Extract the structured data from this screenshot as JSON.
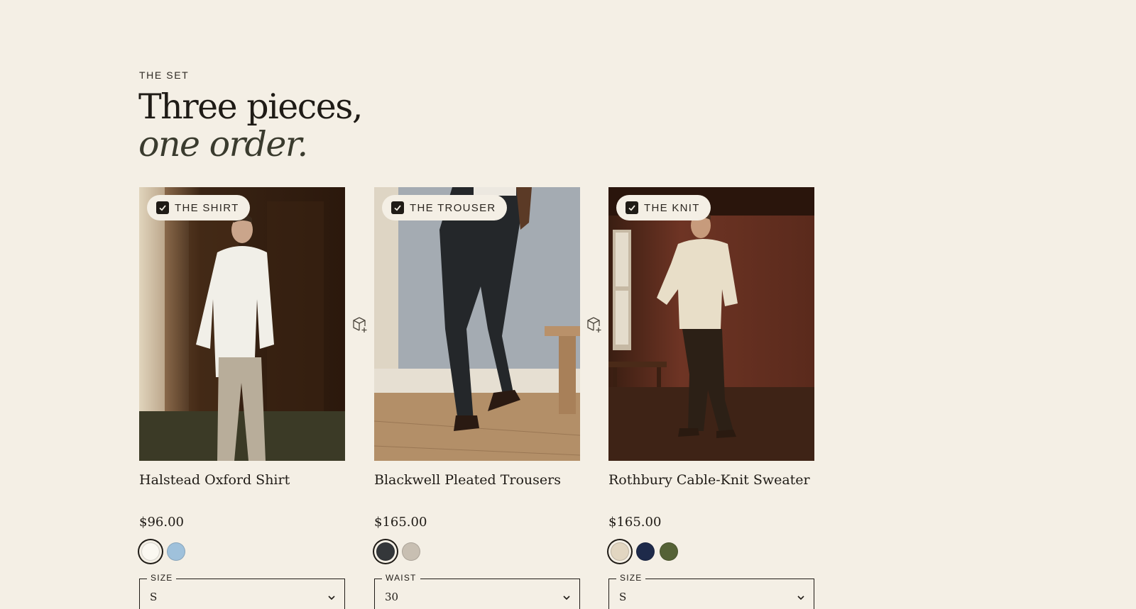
{
  "section": {
    "eyebrow": "THE SET",
    "headline_line1": "Three pieces,",
    "headline_line2": "one order."
  },
  "products": [
    {
      "tag": "THE SHIRT",
      "name": "Halstead Oxford Shirt",
      "price": "$96.00",
      "swatches": [
        "#fbf8f1",
        "#9fc1db"
      ],
      "selected_swatch": 0,
      "select_label": "SIZE",
      "select_value": "S",
      "checked": true
    },
    {
      "tag": "THE TROUSER",
      "name": "Blackwell Pleated Trousers",
      "price": "$165.00",
      "swatches": [
        "#34373a",
        "#c8bfb2"
      ],
      "selected_swatch": 0,
      "select_label": "WAIST",
      "select_value": "30",
      "checked": true
    },
    {
      "tag": "THE KNIT",
      "name": "Rothbury Cable-Knit Sweater",
      "price": "$165.00",
      "swatches": [
        "#e2d6c1",
        "#1e2a4a",
        "#556236"
      ],
      "selected_swatch": 0,
      "select_label": "SIZE",
      "select_value": "S",
      "checked": true
    }
  ],
  "icons": {
    "checkbox": "check-icon",
    "connector": "box-plus-icon",
    "select": "chevron-down-icon"
  },
  "colors": {
    "background": "#f4efe5",
    "text": "#1f1b16"
  }
}
